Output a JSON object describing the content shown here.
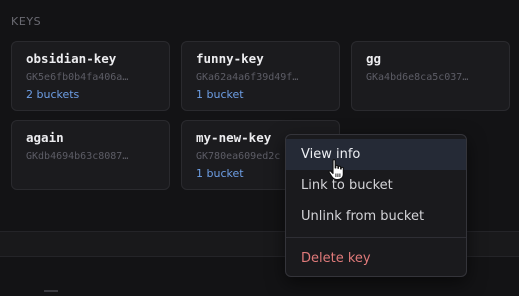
{
  "section": {
    "title": "KEYS"
  },
  "keys": [
    {
      "name": "obsidian-key",
      "id": "GK5e6fb0b4fa406a…",
      "buckets": "2 buckets"
    },
    {
      "name": "funny-key",
      "id": "GKa62a4a6f39d49f…",
      "buckets": "1 bucket"
    },
    {
      "name": "gg",
      "id": "GKa4bd6e8ca5c037…",
      "buckets": ""
    },
    {
      "name": "again",
      "id": "GKdb4694b63c8087…",
      "buckets": ""
    },
    {
      "name": "my-new-key",
      "id": "GK780ea609ed2c",
      "buckets": "1 bucket"
    }
  ],
  "context_menu": {
    "view_info": "View info",
    "link_to_bucket": "Link to bucket",
    "unlink_from_bucket": "Unlink from bucket",
    "delete_key": "Delete key"
  },
  "colors": {
    "accent": "#6e9fe6",
    "danger": "#e07a7a",
    "background": "#131315"
  },
  "icons": {
    "cursor": "hand-pointer-cursor-icon"
  }
}
